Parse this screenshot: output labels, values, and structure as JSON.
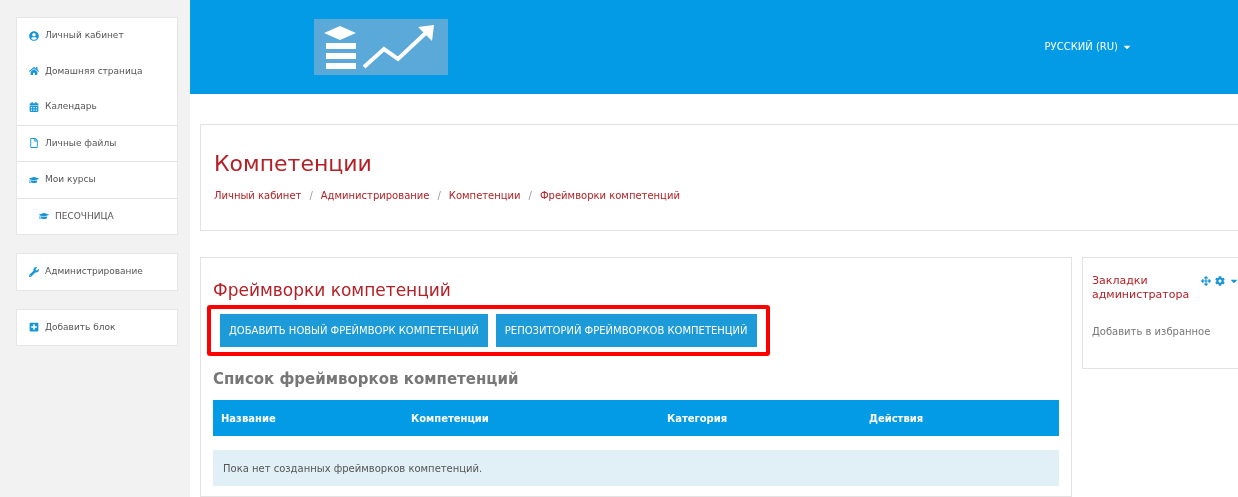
{
  "sidebar": {
    "blocks": [
      {
        "groups": [
          [
            {
              "label": "Личный кабинет"
            },
            {
              "label": "Домашняя страница"
            },
            {
              "label": "Календарь"
            }
          ],
          [
            {
              "label": "Личные файлы"
            }
          ],
          [
            {
              "label": "Мои курсы",
              "children": [
                {
                  "label": "ПЕСОЧНИЦА"
                }
              ]
            }
          ]
        ]
      },
      {
        "groups": [
          [
            {
              "label": "Администрирование"
            }
          ]
        ]
      },
      {
        "groups": [
          [
            {
              "label": "Добавить блок"
            }
          ]
        ]
      }
    ]
  },
  "header": {
    "language": "РУССКИЙ (RU)"
  },
  "page": {
    "title": "Компетенции",
    "separator": "/",
    "breadcrumbs": [
      "Личный кабинет",
      "Администрирование",
      "Компетенции",
      "Фреймворки компетенций"
    ]
  },
  "frameworks": {
    "title": "Фреймворки компетенций",
    "buttons": [
      "ДОБАВИТЬ НОВЫЙ ФРЕЙМВОРК КОМПЕТЕНЦИЙ",
      "РЕПОЗИТОРИЙ ФРЕЙМВОРКОВ КОМПЕТЕНЦИЙ"
    ],
    "highlighted": true,
    "list_title": "Список фреймворков компетенций",
    "table": {
      "columns": [
        "Название",
        "Компетенции",
        "Категория",
        "Действия"
      ],
      "empty_message": "Пока нет созданных фреймворков компетенций."
    }
  },
  "bookmarks": {
    "title": "Закладки администратора",
    "link": "Добавить в избранное"
  }
}
